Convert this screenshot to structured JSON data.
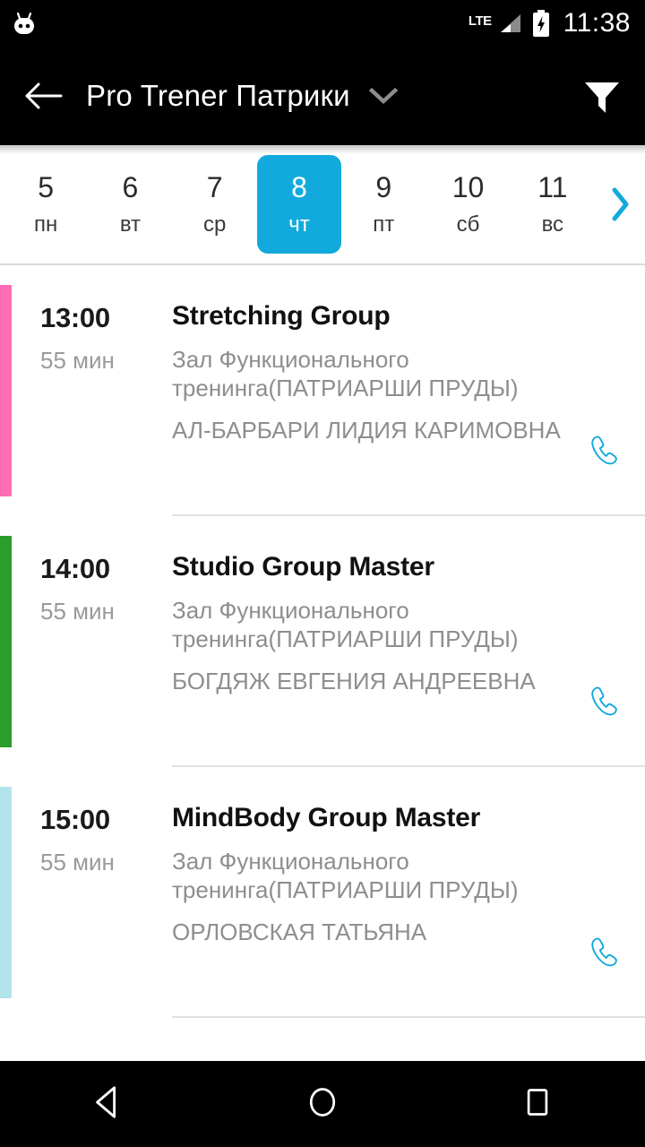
{
  "status_bar": {
    "os_logo_icon": "cyanogenmod-robot-icon",
    "network_label": "LTE",
    "signal_icon": "signal-bars-icon",
    "battery_icon": "battery-charging-icon",
    "time": "11:38"
  },
  "app_bar": {
    "back_icon": "back-arrow-icon",
    "title": "Pro Trener Патрики",
    "dropdown_icon": "chevron-down-icon",
    "filter_icon": "filter-funnel-icon"
  },
  "date_strip": {
    "next_icon": "chevron-right-icon",
    "selected_index": 3,
    "accent_color": "#12AADC",
    "days": [
      {
        "num": "5",
        "dow": "пн"
      },
      {
        "num": "6",
        "dow": "вт"
      },
      {
        "num": "7",
        "dow": "ср"
      },
      {
        "num": "8",
        "dow": "чт"
      },
      {
        "num": "9",
        "dow": "пт"
      },
      {
        "num": "10",
        "dow": "сб"
      },
      {
        "num": "11",
        "dow": "вс"
      }
    ]
  },
  "schedule": {
    "call_icon": "phone-handset-icon",
    "events": [
      {
        "time": "13:00",
        "duration": "55 мин",
        "title": "Stretching Group",
        "place": "Зал Функционального тренинга(ПАТРИАРШИ ПРУДЫ)",
        "coach": "АЛ-БАРБАРИ ЛИДИЯ КАРИМОВНА",
        "color": "#FF6EB4"
      },
      {
        "time": "14:00",
        "duration": "55 мин",
        "title": "Studio Group Master",
        "place": "Зал Функционального тренинга(ПАТРИАРШИ ПРУДЫ)",
        "coach": "БОГДЯЖ ЕВГЕНИЯ АНДРЕЕВНА",
        "color": "#2A9D2A"
      },
      {
        "time": "15:00",
        "duration": "55 мин",
        "title": "MindBody Group Master",
        "place": "Зал Функционального тренинга(ПАТРИАРШИ ПРУДЫ)",
        "coach": "ОРЛОВСКАЯ ТАТЬЯНА",
        "color": "#B3E4EC"
      }
    ]
  },
  "nav_bar": {
    "back_icon": "nav-back-triangle-icon",
    "home_icon": "nav-home-circle-icon",
    "recents_icon": "nav-recents-square-icon"
  }
}
